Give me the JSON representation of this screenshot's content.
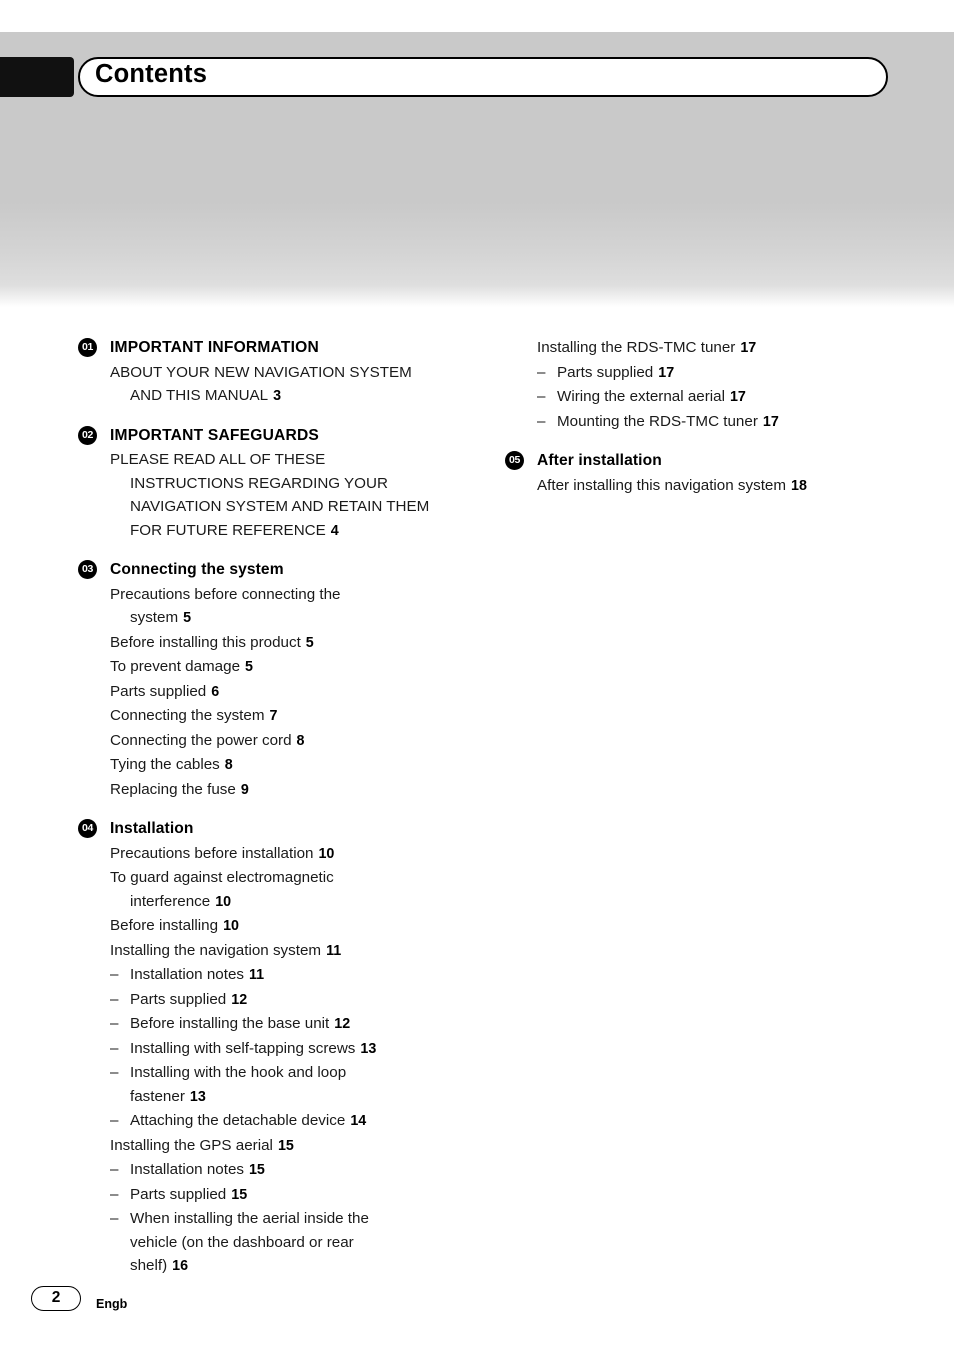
{
  "header": {
    "title": "Contents"
  },
  "footer": {
    "page_number": "2",
    "language": "Engb"
  },
  "columns": {
    "left": [
      {
        "badge": "01",
        "title": "IMPORTANT INFORMATION",
        "caps": true,
        "entries": [
          {
            "label": "ABOUT YOUR NEW NAVIGATION SYSTEM",
            "cont": "AND THIS MANUAL",
            "page": "3",
            "sub": false
          }
        ]
      },
      {
        "badge": "02",
        "title": "IMPORTANT SAFEGUARDS",
        "caps": true,
        "entries": [
          {
            "label": "PLEASE READ ALL OF THESE",
            "cont": "INSTRUCTIONS REGARDING YOUR|NAVIGATION SYSTEM AND RETAIN THEM|FOR FUTURE REFERENCE",
            "page": "4",
            "sub": false
          }
        ]
      },
      {
        "badge": "03",
        "title": "Connecting the system",
        "caps": false,
        "entries": [
          {
            "label": "Precautions before connecting the",
            "cont": "system",
            "page": "5",
            "sub": false
          },
          {
            "label": "Before installing this product",
            "cont": "",
            "page": "5",
            "sub": false
          },
          {
            "label": "To prevent damage",
            "cont": "",
            "page": "5",
            "sub": false
          },
          {
            "label": "Parts supplied",
            "cont": "",
            "page": "6",
            "sub": false
          },
          {
            "label": "Connecting the system",
            "cont": "",
            "page": "7",
            "sub": false
          },
          {
            "label": "Connecting the power cord",
            "cont": "",
            "page": "8",
            "sub": false
          },
          {
            "label": "Tying the cables",
            "cont": "",
            "page": "8",
            "sub": false
          },
          {
            "label": "Replacing the fuse",
            "cont": "",
            "page": "9",
            "sub": false
          }
        ]
      },
      {
        "badge": "04",
        "title": "Installation",
        "caps": false,
        "entries": [
          {
            "label": "Precautions before installation",
            "cont": "",
            "page": "10",
            "sub": false
          },
          {
            "label": "To guard against electromagnetic",
            "cont": "interference",
            "page": "10",
            "sub": false
          },
          {
            "label": "Before installing",
            "cont": "",
            "page": "10",
            "sub": false
          },
          {
            "label": "Installing the navigation system",
            "cont": "",
            "page": "11",
            "sub": false
          },
          {
            "label": "Installation notes",
            "cont": "",
            "page": "11",
            "sub": true
          },
          {
            "label": "Parts supplied",
            "cont": "",
            "page": "12",
            "sub": true
          },
          {
            "label": "Before installing the base unit",
            "cont": "",
            "page": "12",
            "sub": true
          },
          {
            "label": "Installing with self-tapping screws",
            "cont": "",
            "page": "13",
            "sub": true
          },
          {
            "label": "Installing with the hook and loop",
            "cont": "fastener",
            "page": "13",
            "sub": true
          },
          {
            "label": "Attaching the detachable device",
            "cont": "",
            "page": "14",
            "sub": true
          },
          {
            "label": "Installing the GPS aerial",
            "cont": "",
            "page": "15",
            "sub": false
          },
          {
            "label": "Installation notes",
            "cont": "",
            "page": "15",
            "sub": true
          },
          {
            "label": "Parts supplied",
            "cont": "",
            "page": "15",
            "sub": true
          },
          {
            "label": "When installing the aerial inside the",
            "cont": "vehicle (on the dashboard or rear|shelf)",
            "page": "16",
            "sub": true
          }
        ]
      }
    ],
    "right": [
      {
        "badge": "",
        "title": "",
        "caps": false,
        "entries": [
          {
            "label": "Installing the RDS-TMC tuner",
            "cont": "",
            "page": "17",
            "sub": false
          },
          {
            "label": "Parts supplied",
            "cont": "",
            "page": "17",
            "sub": true
          },
          {
            "label": "Wiring the external aerial",
            "cont": "",
            "page": "17",
            "sub": true
          },
          {
            "label": "Mounting the RDS-TMC tuner",
            "cont": "",
            "page": "17",
            "sub": true
          }
        ]
      },
      {
        "badge": "05",
        "title": "After installation",
        "caps": false,
        "entries": [
          {
            "label": "After installing this navigation system",
            "cont": "",
            "page": "18",
            "sub": false
          }
        ]
      }
    ]
  }
}
